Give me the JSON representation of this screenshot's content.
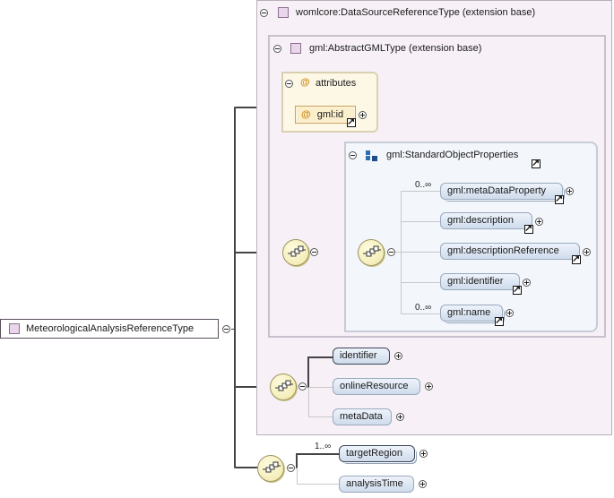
{
  "root": {
    "label": "MeteorologicalAnalysisReferenceType"
  },
  "outer_group": {
    "label": "womlcore:DataSourceReferenceType (extension base)"
  },
  "inner_group": {
    "label": "gml:AbstractGMLType (extension base)"
  },
  "attributes_group": {
    "label": "attributes",
    "symbol": "@",
    "items": [
      {
        "label": "gml:id",
        "symbol": "@"
      }
    ]
  },
  "standard_props": {
    "label": "gml:StandardObjectProperties",
    "items": [
      {
        "label": "gml:metaDataProperty",
        "cardinality": "0..∞"
      },
      {
        "label": "gml:description",
        "cardinality": ""
      },
      {
        "label": "gml:descriptionReference",
        "cardinality": ""
      },
      {
        "label": "gml:identifier",
        "cardinality": ""
      },
      {
        "label": "gml:name",
        "cardinality": "0..∞"
      }
    ]
  },
  "source_elements": [
    {
      "label": "identifier"
    },
    {
      "label": "onlineResource"
    },
    {
      "label": "metaData"
    }
  ],
  "bottom_elements": [
    {
      "label": "targetRegion",
      "cardinality": "1..∞"
    },
    {
      "label": "analysisTime"
    }
  ],
  "icons": {
    "type": "type-square-icon",
    "sequence": "sequence-compositor-icon",
    "reference": "reference-arrow-icon",
    "group": "group-blocks-icon"
  },
  "colors": {
    "group_bg": "#f7f1f7",
    "attr_bg": "#fdf8e6",
    "element_fill": "#dbe5f3",
    "compositor_fill": "#f4edba"
  }
}
